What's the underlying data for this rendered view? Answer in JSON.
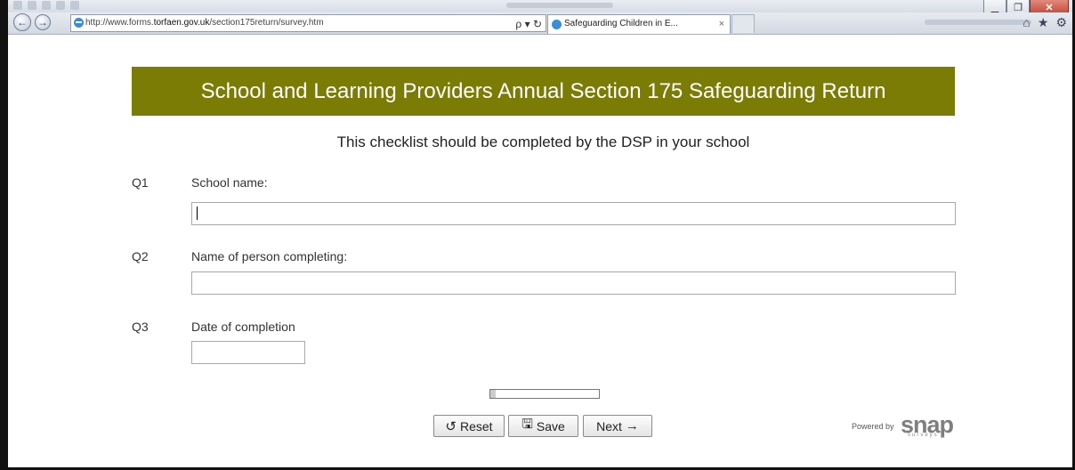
{
  "browser": {
    "url_prefix": "http://www.forms.",
    "url_domain": "torfaen.gov.uk",
    "url_path": "/section175return/survey.htm",
    "tab_title": "Safeguarding Children in E...",
    "tab_close": "×",
    "search_icon": "ρ ▾ ↻"
  },
  "window_buttons": {
    "minimize": "▁",
    "restore": "❐",
    "close": "✕"
  },
  "right_icons": {
    "home": "⌂",
    "favorites": "★",
    "settings": "⚙"
  },
  "page": {
    "banner_title": "School and Learning Providers Annual Section 175 Safeguarding Return",
    "subtitle": "This checklist should be completed by the DSP in your school",
    "questions": [
      {
        "number": "Q1",
        "label": "School name:",
        "value": ""
      },
      {
        "number": "Q2",
        "label": "Name of person completing:",
        "value": ""
      },
      {
        "number": "Q3",
        "label": "Date of completion",
        "value": ""
      }
    ],
    "progress_fraction": 0.05,
    "buttons": {
      "reset_icon": "↺",
      "reset_label": "Reset",
      "save_icon": "🖫",
      "save_label": "Save",
      "next_label": "Next",
      "next_icon": "→"
    },
    "powered_by": "Powered by",
    "logo_text": "snap",
    "logo_sub": "surveys"
  }
}
